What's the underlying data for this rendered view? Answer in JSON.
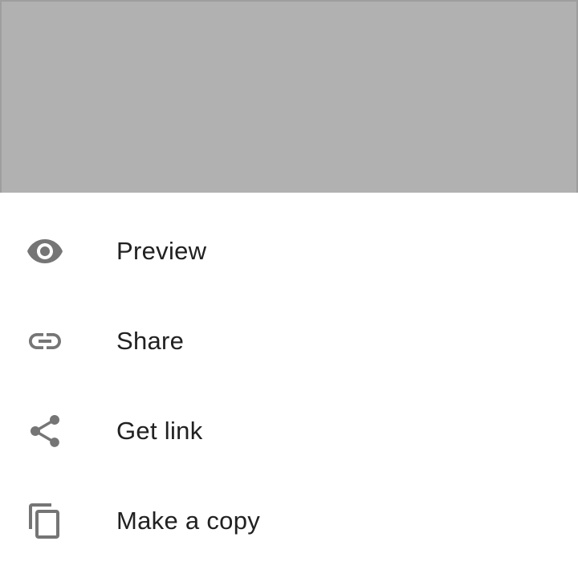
{
  "colors": {
    "scrim": "#b1b1b1",
    "icon": "#757575",
    "text": "#212121",
    "sheet_background": "#ffffff"
  },
  "menu": {
    "items": [
      {
        "label": "Preview",
        "icon": "eye-icon"
      },
      {
        "label": "Share",
        "icon": "link-icon"
      },
      {
        "label": "Get link",
        "icon": "share-icon"
      },
      {
        "label": "Make a copy",
        "icon": "copy-icon"
      }
    ]
  }
}
